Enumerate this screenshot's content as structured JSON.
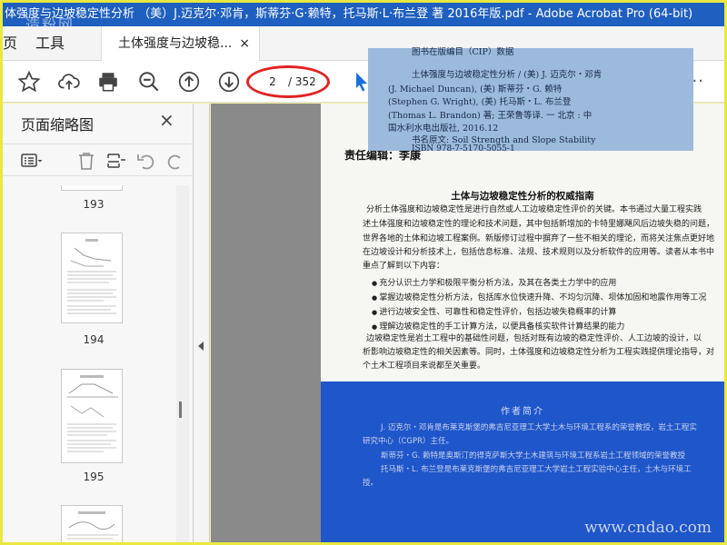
{
  "window": {
    "title": "体强度与边坡稳定性分析 （美）J.迈克尔·邓肯，斯蒂芬·G·赖特，托马斯·L·布兰登 著 2016年版.pdf - Adobe Acrobat Pro (64-bit)",
    "watermark": "造粉网"
  },
  "tabs": {
    "home": "页",
    "tools": "工具",
    "doc": "土体强度与边坡稳...",
    "close": "×"
  },
  "toolbar": {
    "page_current": "2",
    "page_total": "/ 352",
    "more": "···"
  },
  "side_panel": {
    "title": "页面缩略图",
    "close": "×",
    "pages": [
      "193",
      "194",
      "195"
    ]
  },
  "cip": {
    "line0": "图书在版编目（CIP）数据",
    "line1": "土体强度与边坡稳定性分析 / (美) J. 迈克尔・邓肯",
    "line2": "(J. Michael Duncan), (美) 斯蒂芬・G. 赖特",
    "line3": "(Stephen G. Wright), (美) 托马斯・L. 布兰登",
    "line4": "(Thomas L. Brandon) 著; 王荣鲁等译. 一 北京 : 中",
    "line5": "国水利水电出版社, 2016.12",
    "line6": "书名原文: Soil Strength and Slope Stability",
    "line7": "ISBN 978-7-5170-5055-1"
  },
  "page": {
    "header": "责任编辑：李康",
    "title": "土体与边坡稳定性分析的权威指南",
    "para1": [
      "分析土体强度和边坡稳定性是进行自然或人工边坡稳定性评价的关键。本书通过大量工程实践",
      "述土体强度和边坡稳定性的理论和技术问题，其中包括新增加的卡特里娜飓风后边坡失稳的问题，",
      "世界各地的土体和边坡工程案例。新版修订过程中摒弃了一些不相关的理论，而将关注焦点更好地",
      "在边坡设计和分析技术上，包括信息标准、法规、技术规则以及分析软件的应用等。读者从本书中",
      "重点了解到以下内容："
    ],
    "bullets": [
      "充分认识土力学和极限平衡分析方法，及其在各类土力学中的应用",
      "掌握边坡稳定性分析方法，包括库水位快速升降、不均匀沉降、坝体加固和地震作用等工况",
      "进行边坡安全性、可靠性和稳定性评价，包括边坡失稳概率的计算",
      "理解边坡稳定性的手工计算方法，以便具备核实软件计算结果的能力"
    ],
    "para2": [
      "边坡稳定性是岩土工程中的基础性问题，包括对既有边坡的稳定性评价、人工边坡的设计，以",
      "析影响边坡稳定性的相关因素等。同时，土体强度和边坡稳定性分析为工程实践提供理论指导，对",
      "个土木工程项目来说都至关重要。"
    ],
    "author_title": "作者简介",
    "author_lines": [
      "J. 迈克尔・邓肯是布莱克斯堡的弗吉尼亚理工大学土木与环境工程系的荣誉教授，岩土工程实",
      "研究中心（CGPR）主任。",
      "斯蒂芬・G. 赖特是奥斯汀的得克萨斯大学土木建筑与环境工程系岩土工程领域的荣誉教授",
      "托马斯・L. 布兰登是布莱克斯堡的弗吉尼亚理工大学岩土工程实验中心主任，土木与环境工",
      "授。"
    ],
    "watermark": "www.cndao.com"
  }
}
